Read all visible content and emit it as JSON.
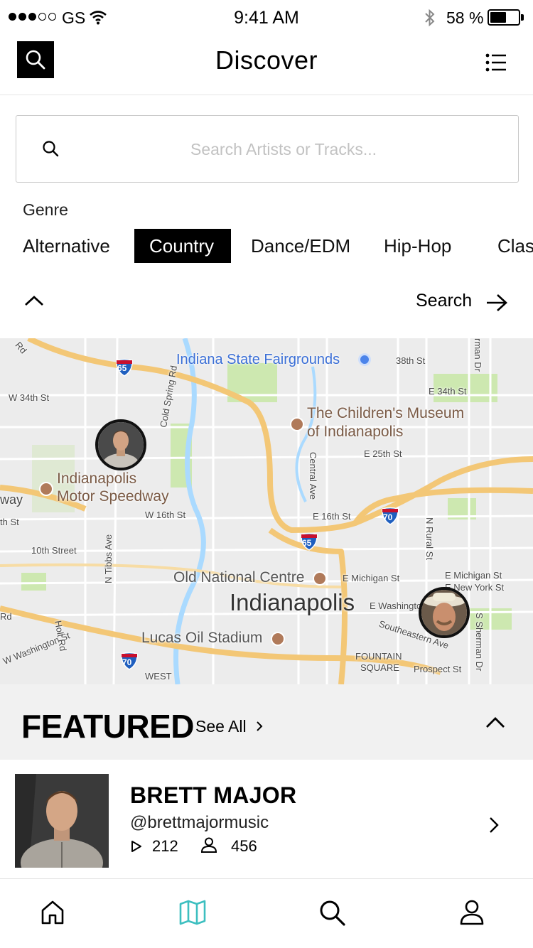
{
  "status_bar": {
    "carrier": "GS",
    "time": "9:41 AM",
    "battery_percent": "58 %",
    "battery_level": 0.58,
    "signal_bars": 3
  },
  "header": {
    "title": "Discover",
    "search_icon": "search-icon",
    "menu_icon": "list-menu-icon"
  },
  "search": {
    "placeholder": "Search Artists or Tracks...",
    "value": ""
  },
  "genre": {
    "label": "Genre",
    "options": [
      "Alternative",
      "Country",
      "Dance/EDM",
      "Hip-Hop",
      "Clas"
    ],
    "selected": "Country"
  },
  "filter_actions": {
    "search_label": "Search"
  },
  "map": {
    "labels": {
      "fairgrounds": "Indiana State Fairgrounds",
      "st38": "38th St",
      "w34": "W 34th St",
      "e34": "E 34th St",
      "museum1": "The Children's Museum",
      "museum2": "of Indianapolis",
      "e25": "E 25th St",
      "speedway1": "Indianapolis",
      "speedway2": "Motor Speedway",
      "way": "way",
      "th_st": "th St",
      "w16": "W 16th St",
      "e16": "E 16th St",
      "tenth": "10th Street",
      "centre": "Old National Centre",
      "city": "Indianapolis",
      "michigan": "E Michigan St",
      "emichigan": "E Michigan St",
      "newyork": "E New York St",
      "ewashington": "E Washington",
      "southeastern": "Southeastern Ave",
      "lucas": "Lucas Oil Stadium",
      "wwash": "W Washington St",
      "fountain1": "FOUNTAIN",
      "fountain2": "SQUARE",
      "prospect": "Prospect St",
      "west": "WEST",
      "rd": "Rd",
      "rd_top": "Rd",
      "cold_spring": "Cold Spring Rd",
      "tibbs": "N Tibbs Ave",
      "holt": "Holt Rd",
      "central": "Central Ave",
      "rural": "N Rural St",
      "sherman": "S Sherman Dr",
      "sherman_top": "rman Dr",
      "i65_top": "65",
      "i65_mid": "65",
      "i70_right": "70",
      "i70_bottom": "70"
    },
    "pins": [
      "artist-pin-brett",
      "artist-pin-cowboy"
    ]
  },
  "featured": {
    "title": "FEATURED",
    "see_all": "See All"
  },
  "artist": {
    "name": "BRETT MAJOR",
    "handle": "@brettmajormusic",
    "plays": "212",
    "followers": "456"
  },
  "tabs": [
    {
      "name": "home",
      "icon": "home-icon"
    },
    {
      "name": "map",
      "icon": "map-icon",
      "active": true
    },
    {
      "name": "search",
      "icon": "search-icon"
    },
    {
      "name": "profile",
      "icon": "user-icon"
    }
  ],
  "colors": {
    "accent": "#3dbfc0",
    "map_land": "#ececec",
    "map_highway": "#f3c776",
    "map_water": "#aadaff",
    "map_park": "#cde8b0"
  }
}
